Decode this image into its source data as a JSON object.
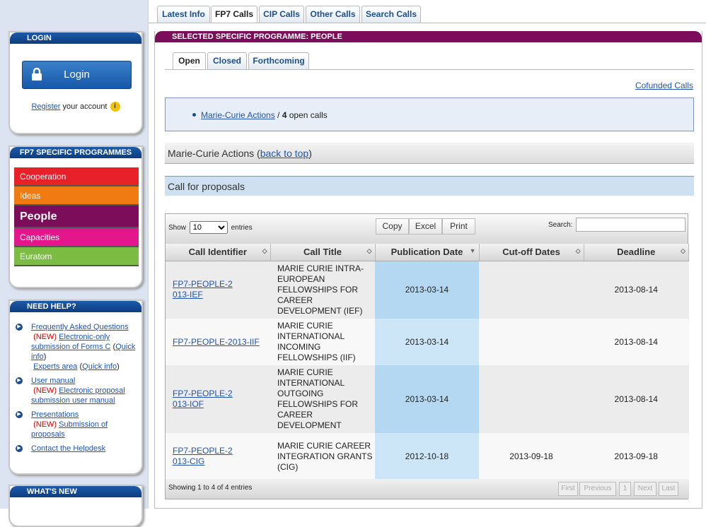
{
  "top_tabs": [
    "Latest Info",
    "FP7 Calls",
    "CIP Calls",
    "Other Calls",
    "Search Calls"
  ],
  "sidebar": {
    "login": {
      "title": "LOGIN",
      "button_label": "Login",
      "register_link": "Register",
      "register_suffix": " your account"
    },
    "programmes": {
      "title": "FP7 SPECIFIC PROGRAMMES",
      "items": [
        {
          "label": "Cooperation",
          "color": "#e8202a"
        },
        {
          "label": "Ideas",
          "color": "#f07b12"
        },
        {
          "label": "People",
          "color": "#7b0d5b"
        },
        {
          "label": "Capacities",
          "color": "#e3168c"
        },
        {
          "label": "Euratom",
          "color": "#7cbc42"
        }
      ]
    },
    "help": {
      "title": "NEED HELP?",
      "faq": "Frequently Asked Questions",
      "new": "(NEW)",
      "eonly": "Electronic-only submission of Forms C",
      "quick_info": "Quick info",
      "experts": "Experts area",
      "user_manual": "User manual",
      "eproposal": "Electronic proposal submission user manual",
      "presentations": "Presentations",
      "submission": "Submission of proposals",
      "contact": "Contact the Helpdesk"
    },
    "whats_new": {
      "title": "WHAT'S NEW"
    }
  },
  "main": {
    "programme_title": "SELECTED SPECIFIC PROGRAMME: PEOPLE",
    "sub_tabs": [
      "Open",
      "Closed",
      "Forthcoming"
    ],
    "cofunded": "Cofunded Calls",
    "summary_link": "Marie-Curie Actions",
    "summary_sep": " / ",
    "summary_count": "4",
    "summary_suffix": " open calls",
    "section_title": "Marie-Curie Actions",
    "back_to_top": "back to top",
    "section_subtitle": "Call for proposals",
    "table": {
      "show_label": "Show",
      "entries_label": "entries",
      "page_size": "10",
      "copy": "Copy",
      "excel": "Excel",
      "print": "Print",
      "search_label": "Search:",
      "columns": [
        "Call Identifier",
        "Call Title",
        "Publication Date",
        "Cut-off Dates",
        "Deadline"
      ],
      "rows": [
        {
          "id": "FP7-PEOPLE-2013-IEF",
          "title": "MARIE CURIE INTRA-EUROPEAN FELLOWSHIPS FOR CAREER DEVELOPMENT (IEF)",
          "pub": "2013-03-14",
          "cutoff": "",
          "deadline": "2013-08-14"
        },
        {
          "id": "FP7-PEOPLE-2013-IIF",
          "title": "MARIE CURIE INTERNATIONAL INCOMING FELLOWSHIPS (IIF)",
          "pub": "2013-03-14",
          "cutoff": "",
          "deadline": "2013-08-14"
        },
        {
          "id": "FP7-PEOPLE-2013-IOF",
          "title": "MARIE CURIE INTERNATIONAL OUTGOING FELLOWSHIPS FOR CAREER DEVELOPMENT",
          "pub": "2013-03-14",
          "cutoff": "",
          "deadline": "2013-08-14"
        },
        {
          "id": "FP7-PEOPLE-2013-CIG",
          "title": "MARIE CURIE CAREER INTEGRATION GRANTS (CIG)",
          "pub": "2012-10-18",
          "cutoff": "2013-09-18",
          "deadline": "2013-09-18"
        }
      ],
      "footer_info": "Showing 1 to 4 of 4 entries",
      "pagination": [
        "First",
        "Previous",
        "1",
        "Next",
        "Last"
      ]
    }
  }
}
